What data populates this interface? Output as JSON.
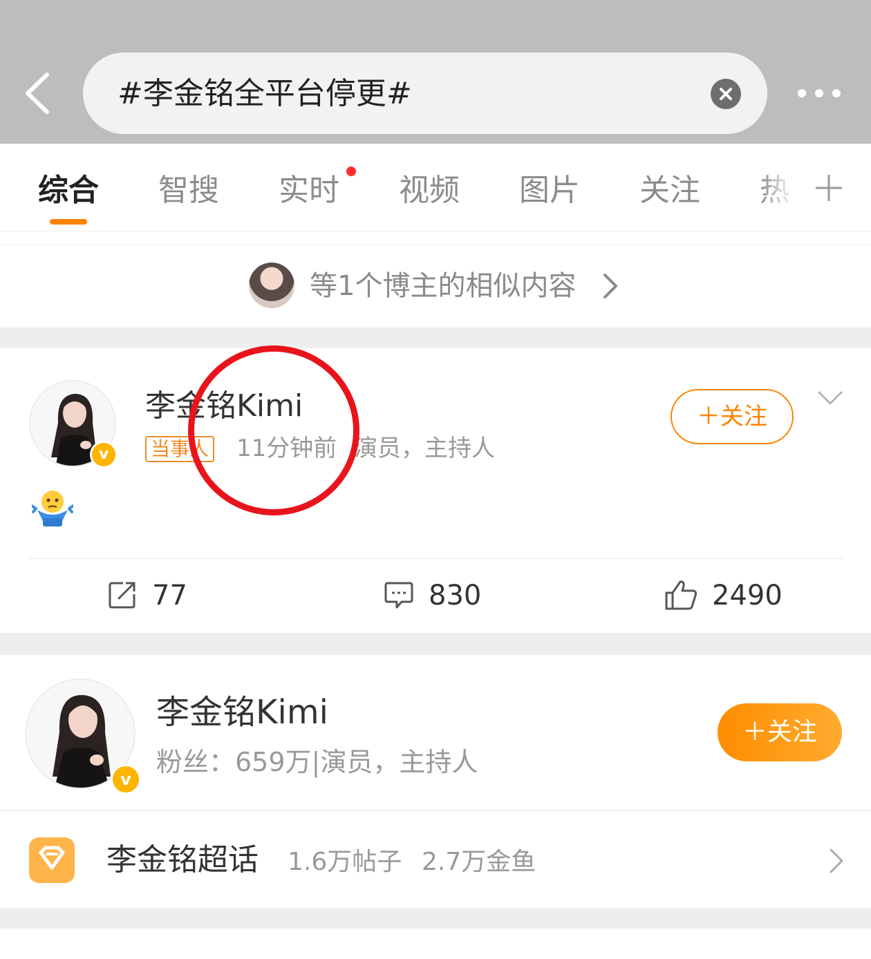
{
  "search": {
    "query": "#李金铭全平台停更#"
  },
  "tabs": [
    {
      "label": "综合",
      "active": true
    },
    {
      "label": "智搜"
    },
    {
      "label": "实时",
      "badge": "red-dot"
    },
    {
      "label": "视频"
    },
    {
      "label": "图片"
    },
    {
      "label": "关注"
    },
    {
      "label": "热"
    }
  ],
  "similar": {
    "text": "等1个博主的相似内容"
  },
  "post": {
    "author": "李金铭Kimi",
    "tag": "当事人",
    "time": "11分钟前",
    "desc": "演员，主持人",
    "follow_label": "＋关注",
    "stats": {
      "reposts": "77",
      "comments": "830",
      "likes": "2490"
    }
  },
  "user_card": {
    "name": "李金铭Kimi",
    "fans": "粉丝：659万|演员，主持人",
    "follow_label": "＋关注"
  },
  "super_topic": {
    "name": "李金铭超话",
    "posts": "1.6万帖子",
    "goldfish": "2.7万金鱼"
  },
  "colors": {
    "accent": "#ff8200",
    "highlight_circle": "#e8141c",
    "header_bg": "#bdbdbd"
  }
}
